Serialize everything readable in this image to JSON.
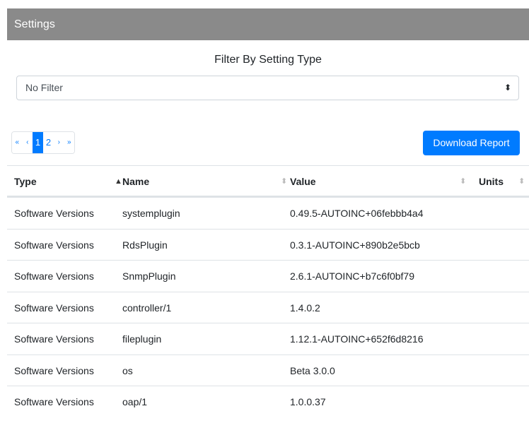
{
  "header": {
    "title": "Settings"
  },
  "filter": {
    "title": "Filter By Setting Type",
    "selected": "No Filter"
  },
  "pagination": {
    "first": "«",
    "prev": "‹",
    "pages": [
      "1",
      "2"
    ],
    "active_page": "1",
    "next": "›",
    "last": "»"
  },
  "toolbar": {
    "download_label": "Download Report"
  },
  "table": {
    "columns": [
      "Type",
      "Name",
      "Value",
      "Units"
    ],
    "sorted_column": "Type",
    "rows": [
      {
        "type": "Software Versions",
        "name": "systemplugin",
        "value": "0.49.5-AUTOINC+06febbb4a4",
        "units": ""
      },
      {
        "type": "Software Versions",
        "name": "RdsPlugin",
        "value": "0.3.1-AUTOINC+890b2e5bcb",
        "units": ""
      },
      {
        "type": "Software Versions",
        "name": "SnmpPlugin",
        "value": "2.6.1-AUTOINC+b7c6f0bf79",
        "units": ""
      },
      {
        "type": "Software Versions",
        "name": "controller/1",
        "value": "1.4.0.2",
        "units": ""
      },
      {
        "type": "Software Versions",
        "name": "fileplugin",
        "value": "1.12.1-AUTOINC+652f6d8216",
        "units": ""
      },
      {
        "type": "Software Versions",
        "name": "os",
        "value": "Beta 3.0.0",
        "units": ""
      },
      {
        "type": "Software Versions",
        "name": "oap/1",
        "value": "1.0.0.37",
        "units": ""
      }
    ]
  },
  "colors": {
    "header_bg": "#8a8a8a",
    "accent": "#007bff"
  },
  "icons": {
    "select_caret": "sort-caret-icon",
    "sort_indicator": "sort-arrows-icon"
  }
}
